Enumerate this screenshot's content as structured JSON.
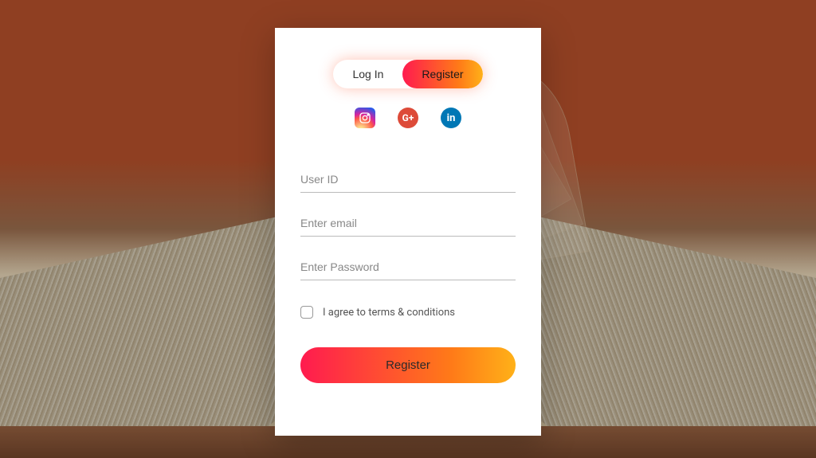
{
  "tabs": {
    "login": "Log In",
    "register": "Register",
    "active": "register"
  },
  "social": {
    "instagram": "instagram",
    "googleplus": "G+",
    "linkedin": "in"
  },
  "form": {
    "userid_placeholder": "User ID",
    "email_placeholder": "Enter email",
    "password_placeholder": "Enter Password",
    "terms_label": "I agree to terms & conditions",
    "submit_label": "Register"
  }
}
